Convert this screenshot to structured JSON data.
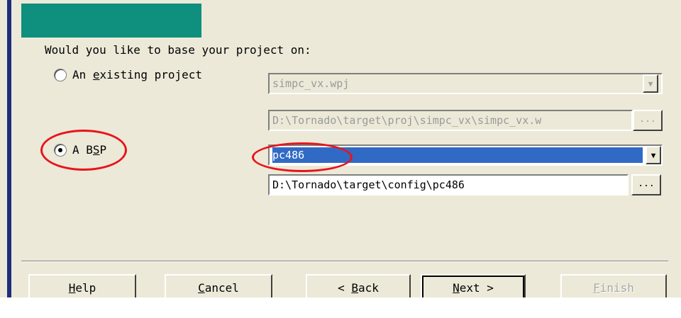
{
  "question": "Would you like to base your project on:",
  "options": {
    "existing_project": {
      "label_before": "An ",
      "label_mnemonic": "e",
      "label_after": "xisting project",
      "checked": false
    },
    "bsp": {
      "label_before": "A B",
      "label_mnemonic": "S",
      "label_after": "P",
      "checked": true
    }
  },
  "existing": {
    "project_select": "simpc_vx.wpj",
    "project_path": "D:\\Tornado\\target\\proj\\simpc_vx\\simpc_vx.w"
  },
  "bsp": {
    "select_value": "pc486",
    "path": "D:\\Tornado\\target\\config\\pc486"
  },
  "browse_label": "...",
  "buttons": {
    "help": {
      "mnemonic": "H",
      "rest": "elp"
    },
    "cancel": {
      "mnemonic": "C",
      "rest": "ancel"
    },
    "back": {
      "prefix": "< ",
      "mnemonic": "B",
      "rest": "ack"
    },
    "next": {
      "mnemonic": "N",
      "rest": "ext >"
    },
    "finish": {
      "mnemonic": "F",
      "rest": "inish"
    }
  },
  "colors": {
    "header": "#0f8f7e",
    "selection": "#316ac5",
    "highlight_ellipse": "#e8141b"
  },
  "icons": {
    "dropdown": "chevron-down-icon"
  }
}
